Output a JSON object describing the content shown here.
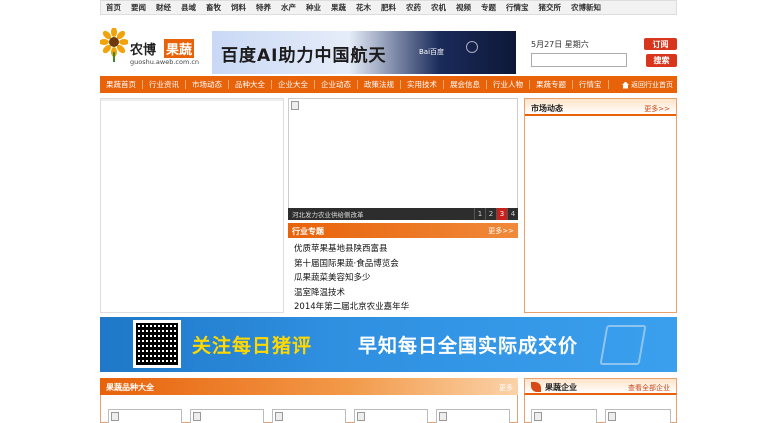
{
  "topnav": [
    "首页",
    "要闻",
    "财经",
    "县域",
    "畜牧",
    "饲料",
    "特养",
    "水产",
    "种业",
    "果蔬",
    "花木",
    "肥料",
    "农药",
    "农机",
    "视频",
    "专题",
    "行情宝",
    "猪交所",
    "农博新知"
  ],
  "logo": {
    "name1": "农博",
    "name2": "果蔬",
    "url": "guoshu.aweb.com.cn"
  },
  "ad_banner": {
    "text": "百度AI助力中国航天",
    "brand": "Bai百度"
  },
  "header": {
    "date": "5月27日 星期六",
    "subscribe_label": "订阅",
    "search_label": "搜索",
    "search_value": ""
  },
  "mainnav": [
    "果蔬首页",
    "行业资讯",
    "市场动态",
    "品种大全",
    "企业大全",
    "企业动态",
    "政策法规",
    "实用技术",
    "展会信息",
    "行业人物",
    "果蔬专题",
    "行情宝"
  ],
  "mainnav_back": "返回行业首页",
  "slideshow": {
    "caption": "河北发力农业供给侧改革",
    "pages": [
      "1",
      "2",
      "3",
      "4"
    ],
    "active_page": "3"
  },
  "topics": {
    "title": "行业专题",
    "more": "更多>>",
    "items": [
      "优质苹果基地县陕西富县",
      "第十届国际果蔬·食品博览会",
      "瓜果蔬菜美容知多少",
      "温室降温技术",
      "2014年第二届北京农业嘉年华"
    ]
  },
  "market": {
    "title": "市场动态",
    "more": "更多>>"
  },
  "pig_ad": {
    "text1": "关注每日猪评",
    "text2": "早知每日全国实际成交价"
  },
  "variety": {
    "title": "果蔬品种大全",
    "more": "更多"
  },
  "enterprise": {
    "title": "果蔬企业",
    "more": "查看全部企业"
  }
}
